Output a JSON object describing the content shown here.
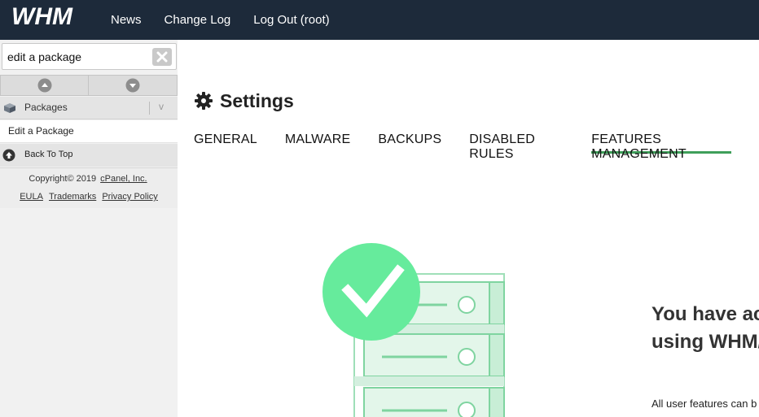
{
  "topbar": {
    "logo_text": "WHM",
    "nav": [
      "News",
      "Change Log",
      "Log Out (root)"
    ]
  },
  "sidebar": {
    "search": {
      "value": "edit a package",
      "placeholder": ""
    },
    "category_label": "Packages",
    "category_chevron": "v",
    "result_label": "Edit a Package",
    "back_to_top": "Back To Top",
    "footer": {
      "copyright_prefix": "Copyright© 2019 ",
      "company_link": "cPanel, Inc.",
      "links": [
        "EULA",
        "Trademarks",
        "Privacy Policy"
      ]
    }
  },
  "main": {
    "title": "Settings",
    "tabs": [
      {
        "label": "GENERAL",
        "active": false
      },
      {
        "label": "MALWARE",
        "active": false
      },
      {
        "label": "BACKUPS",
        "active": false
      },
      {
        "label": "DISABLED RULES",
        "active": false
      },
      {
        "label": "FEATURES MANAGEMENT",
        "active": true
      }
    ],
    "message_line1": "You have ac",
    "message_line2": "using WHM/",
    "note": "All user features can b"
  },
  "colors": {
    "topbar_bg": "#1d2a3a",
    "tab_active_underline": "#3f9f5a",
    "check_circle": "#66eb9c",
    "server_fill": "#e3f6ea",
    "server_stroke": "#7fd4a0"
  },
  "icons": {
    "clear": "close-icon",
    "up": "chevron-up-icon",
    "down": "chevron-down-icon",
    "packages": "box-icon",
    "back_to_top": "arrow-up-circle-icon",
    "settings": "gear-icon",
    "illustration": "check-circle-server-icon"
  }
}
